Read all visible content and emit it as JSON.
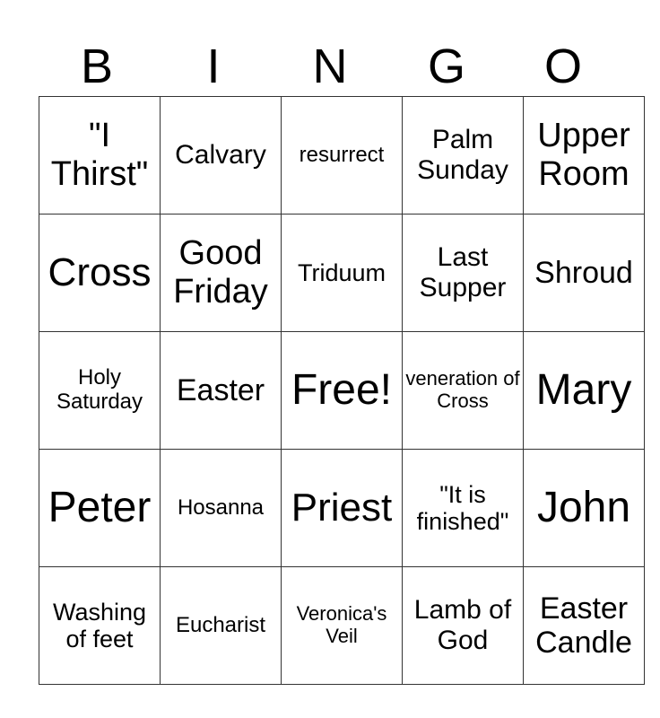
{
  "header": {
    "letters": [
      "B",
      "I",
      "N",
      "G",
      "O"
    ]
  },
  "rows": [
    [
      "\"I Thirst\"",
      "Calvary",
      "resurrect",
      "Palm Sunday",
      "Upper Room"
    ],
    [
      "Cross",
      "Good Friday",
      "Triduum",
      "Last Supper",
      "Shroud"
    ],
    [
      "Holy Saturday",
      "Easter",
      "Free!",
      "veneration of Cross",
      "Mary"
    ],
    [
      "Peter",
      "Hosanna",
      "Priest",
      "\"It is finished\"",
      "John"
    ],
    [
      "Washing of feet",
      "Eucharist",
      "Veronica's Veil",
      "Lamb of God",
      "Easter Candle"
    ]
  ]
}
